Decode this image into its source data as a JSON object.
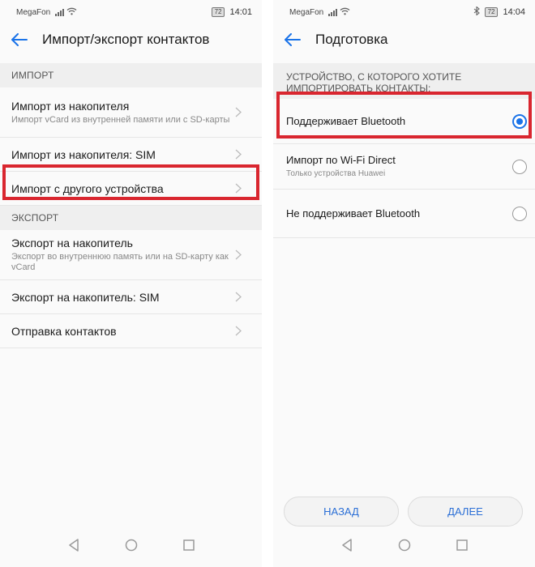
{
  "left": {
    "status": {
      "carrier": "MegaFon",
      "battery": "72",
      "time": "14:01"
    },
    "title": "Импорт/экспорт контактов",
    "import_header": "ИМПОРТ",
    "import_items": [
      {
        "primary": "Импорт из накопителя",
        "secondary": "Импорт vCard из внутренней памяти или с SD-карты"
      },
      {
        "primary": "Импорт из накопителя: SIM",
        "secondary": ""
      },
      {
        "primary": "Импорт с другого устройства",
        "secondary": ""
      }
    ],
    "export_header": "ЭКСПОРТ",
    "export_items": [
      {
        "primary": "Экспорт на накопитель",
        "secondary": "Экспорт во внутреннюю память или на SD-карту как vCard"
      },
      {
        "primary": "Экспорт на накопитель: SIM",
        "secondary": ""
      },
      {
        "primary": "Отправка контактов",
        "secondary": ""
      }
    ]
  },
  "right": {
    "status": {
      "carrier": "MegaFon",
      "battery": "72",
      "time": "14:04"
    },
    "title": "Подготовка",
    "section_header": "УСТРОЙСТВО, С КОТОРОГО ХОТИТЕ ИМПОРТИРОВАТЬ КОНТАКТЫ:",
    "options": [
      {
        "primary": "Поддерживает Bluetooth",
        "secondary": "",
        "checked": true
      },
      {
        "primary": "Импорт по Wi-Fi Direct",
        "secondary": "Только устройства Huawei",
        "checked": false
      },
      {
        "primary": "Не поддерживает Bluetooth",
        "secondary": "",
        "checked": false
      }
    ],
    "back_label": "НАЗАД",
    "next_label": "ДАЛЕЕ"
  },
  "colors": {
    "accent": "#1a73e8",
    "highlight": "#d9262f",
    "button_text": "#2b6fd6"
  }
}
